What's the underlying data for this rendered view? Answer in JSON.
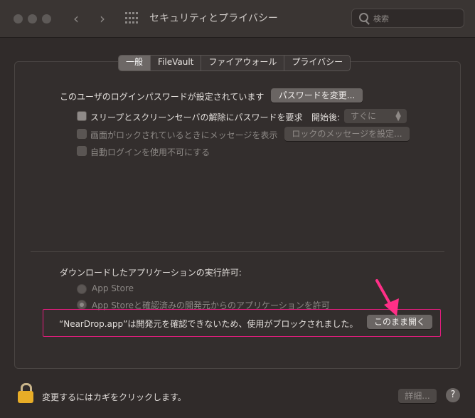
{
  "window": {
    "title": "セキュリティとプライバシー"
  },
  "toolbar": {
    "back_icon": "‹",
    "forward_icon": "›",
    "grid_icon": "grid-icon"
  },
  "search": {
    "placeholder": "検索"
  },
  "tabs": [
    {
      "label": "一般"
    },
    {
      "label": "FileVault"
    },
    {
      "label": "ファイアウォール"
    },
    {
      "label": "プライバシー"
    }
  ],
  "general": {
    "password_text": "このユーザのログインパスワードが設定されています",
    "change_password_label": "パスワードを変更...",
    "require_password_label": "スリープとスクリーンセーバの解除にパスワードを要求",
    "start_after_label": "開始後:",
    "start_after_value": "すぐに",
    "lock_message_label": "画面がロックされているときにメッセージを表示",
    "set_lock_message_label": "ロックのメッセージを設定...",
    "disable_auto_login_label": "自動ログインを使用不可にする"
  },
  "downloads": {
    "heading": "ダウンロードしたアプリケーションの実行許可:",
    "option_app_store": "App Store",
    "option_app_store_identified": "App Storeと確認済みの開発元からのアプリケーションを許可",
    "blocked_message": "“NearDrop.app”は開発元を確認できないため、使用がブロックされました。",
    "open_anyway_label": "このまま開く"
  },
  "footer": {
    "lock_text": "変更するにはカギをクリックします。",
    "advanced_label": "詳細...",
    "help_label": "?"
  },
  "colors": {
    "highlight": "#e11d7c",
    "arrow": "#ff2f87",
    "lock": "#e8ad27"
  }
}
